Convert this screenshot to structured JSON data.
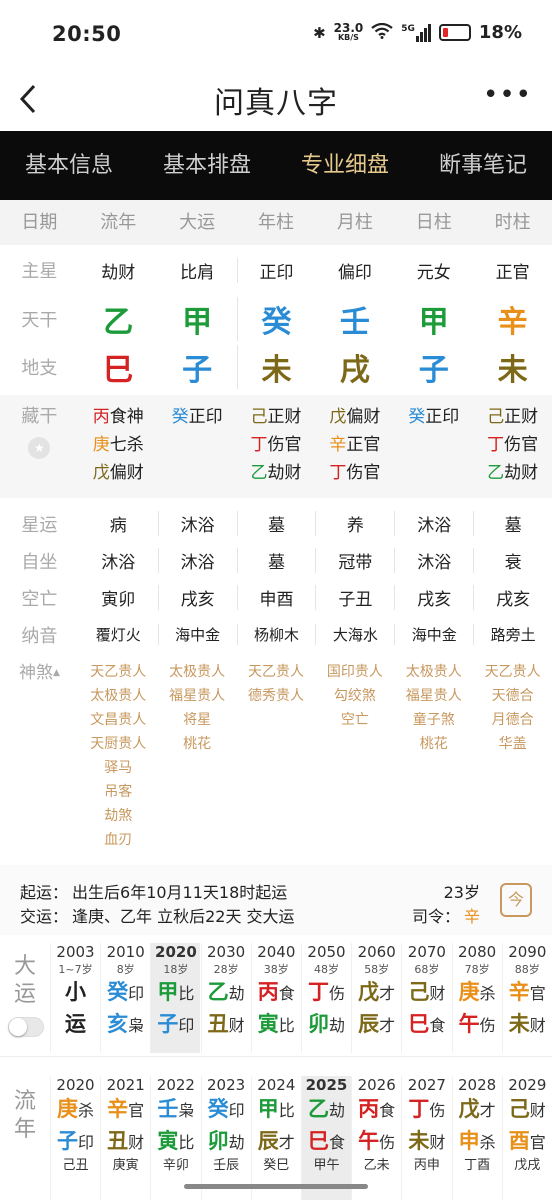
{
  "status": {
    "time": "20:50",
    "speed": "23.0",
    "speed_unit": "KB/S",
    "battery": "18%",
    "network": "5G"
  },
  "navbar": {
    "title": "问真八字"
  },
  "tabs": [
    "基本信息",
    "基本排盘",
    "专业细盘",
    "断事笔记"
  ],
  "table_header": [
    "日期",
    "流年",
    "大运",
    "年柱",
    "月柱",
    "日柱",
    "时柱"
  ],
  "labels": {
    "zhuxing": "主星",
    "tiangan": "天干",
    "dizhi": "地支",
    "canggan": "藏干",
    "xingyun": "星运",
    "zizuo": "自坐",
    "kongwang": "空亡",
    "nayin": "纳音",
    "shensha": "神煞"
  },
  "zhuxing": [
    "劫财",
    "比肩",
    "正印",
    "偏印",
    "元女",
    "正官"
  ],
  "tiangan": [
    "乙",
    "甲",
    "癸",
    "壬",
    "甲",
    "辛"
  ],
  "dizhi": [
    "巳",
    "子",
    "未",
    "戌",
    "子",
    "未"
  ],
  "canggan": [
    [
      {
        "g": "丙",
        "s": "食神"
      },
      {
        "g": "庚",
        "s": "七杀"
      },
      {
        "g": "戊",
        "s": "偏财"
      }
    ],
    [
      {
        "g": "癸",
        "s": "正印"
      }
    ],
    [
      {
        "g": "己",
        "s": "正财"
      },
      {
        "g": "丁",
        "s": "伤官"
      },
      {
        "g": "乙",
        "s": "劫财"
      }
    ],
    [
      {
        "g": "戊",
        "s": "偏财"
      },
      {
        "g": "辛",
        "s": "正官"
      },
      {
        "g": "丁",
        "s": "伤官"
      }
    ],
    [
      {
        "g": "癸",
        "s": "正印"
      }
    ],
    [
      {
        "g": "己",
        "s": "正财"
      },
      {
        "g": "丁",
        "s": "伤官"
      },
      {
        "g": "乙",
        "s": "劫财"
      }
    ]
  ],
  "xingyun": [
    "病",
    "沐浴",
    "墓",
    "养",
    "沐浴",
    "墓"
  ],
  "zizuo": [
    "沐浴",
    "沐浴",
    "墓",
    "冠带",
    "沐浴",
    "衰"
  ],
  "kongwang": [
    "寅卯",
    "戌亥",
    "申酉",
    "子丑",
    "戌亥",
    "戌亥"
  ],
  "nayin": [
    "覆灯火",
    "海中金",
    "杨柳木",
    "大海水",
    "海中金",
    "路旁土"
  ],
  "shensha": [
    [
      "天乙贵人",
      "太极贵人",
      "文昌贵人",
      "天厨贵人",
      "驿马",
      "吊客",
      "劫煞",
      "血刃"
    ],
    [
      "太极贵人",
      "福星贵人",
      "将星",
      "桃花"
    ],
    [
      "天乙贵人",
      "德秀贵人"
    ],
    [
      "国印贵人",
      "勾绞煞",
      "空亡"
    ],
    [
      "太极贵人",
      "福星贵人",
      "童子煞",
      "桃花"
    ],
    [
      "天乙贵人",
      "天德合",
      "月德合",
      "华盖"
    ]
  ],
  "info": {
    "qiyun_label": "起运：",
    "qiyun": "出生后6年10月11天18时起运",
    "jiaoyun_label": "交运：",
    "jiaoyun": "逢庚、乙年 立秋后22天 交大运",
    "age": "23岁",
    "siling_label": "司令：",
    "siling": "辛",
    "calendar_label": "今"
  },
  "dayun": {
    "side": [
      "大",
      "运"
    ],
    "cols": [
      {
        "yr": "2003",
        "age": "1~7岁",
        "g": "小",
        "gs": "",
        "z": "运",
        "zs": ""
      },
      {
        "yr": "2010",
        "age": "8岁",
        "g": "癸",
        "gs": "印",
        "z": "亥",
        "zs": "枭"
      },
      {
        "yr": "2020",
        "age": "18岁",
        "g": "甲",
        "gs": "比",
        "z": "子",
        "zs": "印"
      },
      {
        "yr": "2030",
        "age": "28岁",
        "g": "乙",
        "gs": "劫",
        "z": "丑",
        "zs": "财"
      },
      {
        "yr": "2040",
        "age": "38岁",
        "g": "丙",
        "gs": "食",
        "z": "寅",
        "zs": "比"
      },
      {
        "yr": "2050",
        "age": "48岁",
        "g": "丁",
        "gs": "伤",
        "z": "卯",
        "zs": "劫"
      },
      {
        "yr": "2060",
        "age": "58岁",
        "g": "戊",
        "gs": "才",
        "z": "辰",
        "zs": "才"
      },
      {
        "yr": "2070",
        "age": "68岁",
        "g": "己",
        "gs": "财",
        "z": "巳",
        "zs": "食"
      },
      {
        "yr": "2080",
        "age": "78岁",
        "g": "庚",
        "gs": "杀",
        "z": "午",
        "zs": "伤"
      },
      {
        "yr": "2090",
        "age": "88岁",
        "g": "辛",
        "gs": "官",
        "z": "未",
        "zs": "财"
      }
    ]
  },
  "liunian": {
    "side": [
      "流",
      "年"
    ],
    "cols": [
      {
        "yr": "2020",
        "g": "庚",
        "gs": "杀",
        "z": "子",
        "zs": "印",
        "n": "己丑"
      },
      {
        "yr": "2021",
        "g": "辛",
        "gs": "官",
        "z": "丑",
        "zs": "财",
        "n": "庚寅"
      },
      {
        "yr": "2022",
        "g": "壬",
        "gs": "枭",
        "z": "寅",
        "zs": "比",
        "n": "辛卯"
      },
      {
        "yr": "2023",
        "g": "癸",
        "gs": "印",
        "z": "卯",
        "zs": "劫",
        "n": "壬辰"
      },
      {
        "yr": "2024",
        "g": "甲",
        "gs": "比",
        "z": "辰",
        "zs": "才",
        "n": "癸巳"
      },
      {
        "yr": "2025",
        "g": "乙",
        "gs": "劫",
        "z": "巳",
        "zs": "食",
        "n": "甲午"
      },
      {
        "yr": "2026",
        "g": "丙",
        "gs": "食",
        "z": "午",
        "zs": "伤",
        "n": "乙未"
      },
      {
        "yr": "2027",
        "g": "丁",
        "gs": "伤",
        "z": "未",
        "zs": "财",
        "n": "丙申"
      },
      {
        "yr": "2028",
        "g": "戊",
        "gs": "才",
        "z": "申",
        "zs": "杀",
        "n": "丁酉"
      },
      {
        "yr": "2029",
        "g": "己",
        "gs": "财",
        "z": "酉",
        "zs": "官",
        "n": "戊戌"
      }
    ]
  }
}
